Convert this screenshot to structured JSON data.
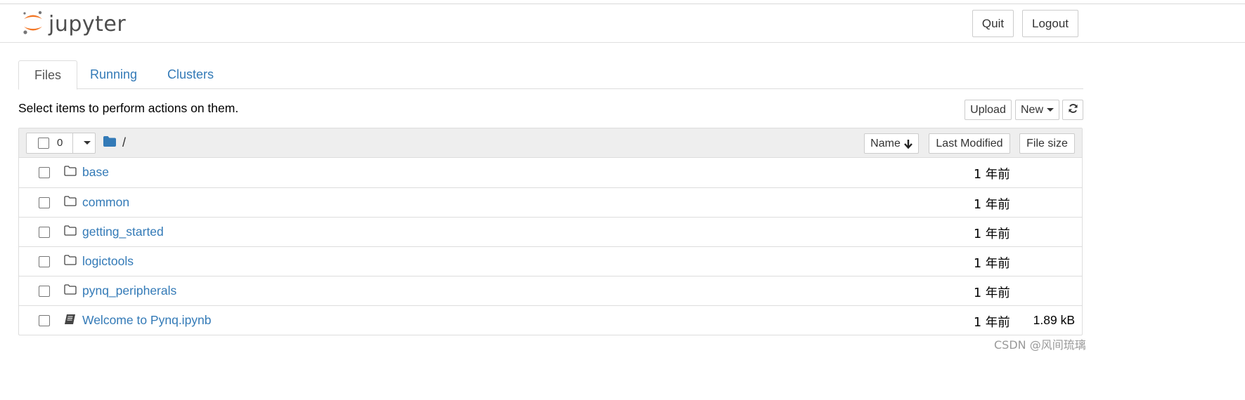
{
  "header": {
    "logo_text": "jupyter",
    "quit_label": "Quit",
    "logout_label": "Logout"
  },
  "tabs": [
    {
      "label": "Files",
      "active": true
    },
    {
      "label": "Running",
      "active": false
    },
    {
      "label": "Clusters",
      "active": false
    }
  ],
  "toolbar": {
    "hint": "Select items to perform actions on them.",
    "upload_label": "Upload",
    "new_label": "New"
  },
  "list_header": {
    "selected_count": "0",
    "breadcrumb": "/",
    "sort_name_label": "Name",
    "sort_modified_label": "Last Modified",
    "sort_size_label": "File size"
  },
  "items": [
    {
      "name": "base",
      "type": "folder",
      "modified": "1 年前",
      "size": ""
    },
    {
      "name": "common",
      "type": "folder",
      "modified": "1 年前",
      "size": ""
    },
    {
      "name": "getting_started",
      "type": "folder",
      "modified": "1 年前",
      "size": ""
    },
    {
      "name": "logictools",
      "type": "folder",
      "modified": "1 年前",
      "size": ""
    },
    {
      "name": "pynq_peripherals",
      "type": "folder",
      "modified": "1 年前",
      "size": ""
    },
    {
      "name": "Welcome to Pynq.ipynb",
      "type": "notebook",
      "modified": "1 年前",
      "size": "1.89 kB"
    }
  ],
  "watermark": "CSDN @风间琉璃",
  "colors": {
    "link": "#337ab7",
    "jupyter_orange": "#f37726",
    "header_bg": "#eeeeee"
  }
}
